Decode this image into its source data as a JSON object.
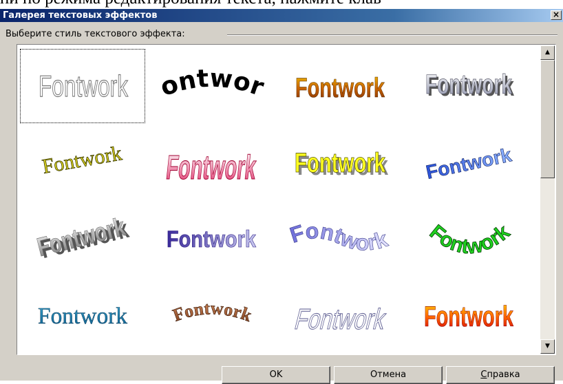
{
  "background_doc_text": "ни по режима редактирования текста, нажмите клав",
  "dialog": {
    "title": "Галерея текстовых эффектов",
    "close_glyph": "×",
    "group_label": "Выберите стиль текстового эффекта:"
  },
  "gallery": {
    "items": [
      {
        "text": "Fontwork",
        "style": "outline-plain"
      },
      {
        "text": "Fontwork",
        "style": "black-arc-bold"
      },
      {
        "text": "Fontwork",
        "style": "gold-gradient"
      },
      {
        "text": "Fontwork",
        "style": "silver-bevel"
      },
      {
        "text": "Fontwork",
        "style": "olive-serif-slant"
      },
      {
        "text": "Fontwork",
        "style": "pink-perspective"
      },
      {
        "text": "Fontwork",
        "style": "yellow-shadow"
      },
      {
        "text": "Fontwork",
        "style": "blue-3d-rise"
      },
      {
        "text": "Fontwork",
        "style": "grey-extrude"
      },
      {
        "text": "Fontwork",
        "style": "purple-3d-fade"
      },
      {
        "text": "Fontwork",
        "style": "lilac-wave"
      },
      {
        "text": "Fontwork",
        "style": "green-arch"
      },
      {
        "text": "Fontwork",
        "style": "teal-serif"
      },
      {
        "text": "Fontwork",
        "style": "brown-arch"
      },
      {
        "text": "Fontwork",
        "style": "outline-skew"
      },
      {
        "text": "Fontwork",
        "style": "fire-gradient"
      }
    ],
    "selected_index": 0
  },
  "scrollbar": {
    "up_glyph": "▲",
    "down_glyph": "▼"
  },
  "buttons": {
    "ok": "OK",
    "cancel": "Отмена",
    "help": "Справка"
  },
  "colors": {
    "title_bar": "#0a246a",
    "face": "#d4d0c8"
  }
}
